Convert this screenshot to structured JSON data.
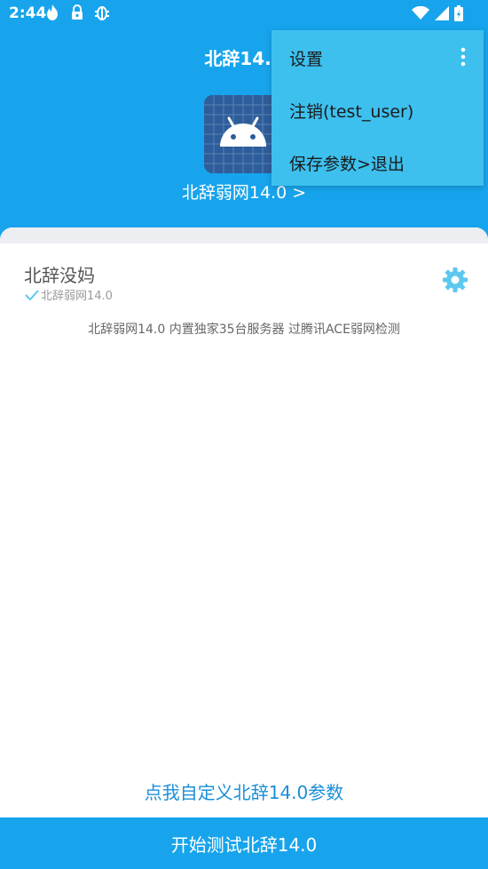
{
  "status_bar": {
    "time": "2:44",
    "left_icons": [
      "flame-icon",
      "lock-icon",
      "bug-icon"
    ],
    "right_icons": [
      "wifi-icon",
      "signal-icon",
      "battery-icon"
    ]
  },
  "header": {
    "title": "北辞14.0",
    "subtitle_link": "北辞弱网14.0 >",
    "logo": "android-icon"
  },
  "card": {
    "user_name": "北辞没妈",
    "version_label": "北辞弱网14.0",
    "description": "北辞弱网14.0 内置独家35台服务器 过腾讯ACE弱网检测"
  },
  "footer": {
    "custom_params_link": "点我自定义北辞14.0参数",
    "start_button": "开始测试北辞14.0"
  },
  "popup_menu": {
    "items": [
      {
        "label": "设置"
      },
      {
        "label": "注销(test_user)"
      },
      {
        "label": "保存参数>退出"
      }
    ]
  },
  "colors": {
    "primary": "#17a4ec",
    "menu_bg": "#3dc0ee",
    "link": "#1a8fd8",
    "gear": "#5cc8f0"
  }
}
